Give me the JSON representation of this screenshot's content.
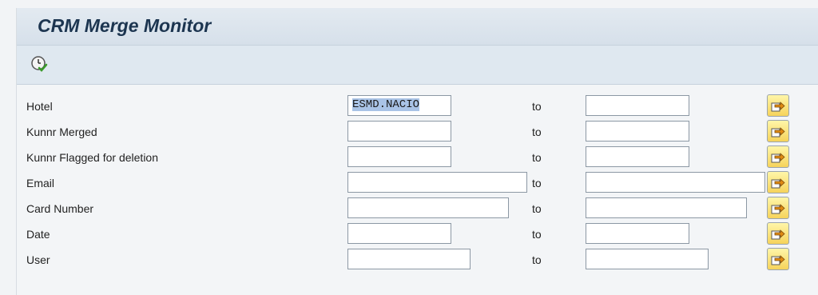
{
  "title": "CRM Merge Monitor",
  "toolbar": {
    "execute_icon": "execute-clock-icon"
  },
  "to_label": "to",
  "rows": [
    {
      "label": "Hotel",
      "from": "ESMD.NACIO",
      "to": "",
      "selected": true
    },
    {
      "label": "Kunnr Merged",
      "from": "",
      "to": ""
    },
    {
      "label": "Kunnr Flagged for deletion",
      "from": "",
      "to": ""
    },
    {
      "label": "Email",
      "from": "",
      "to": ""
    },
    {
      "label": "Card Number",
      "from": "",
      "to": ""
    },
    {
      "label": "Date",
      "from": "",
      "to": ""
    },
    {
      "label": "User",
      "from": "",
      "to": ""
    }
  ],
  "multiple_selection_icon": "multiple-selection-arrow-icon"
}
